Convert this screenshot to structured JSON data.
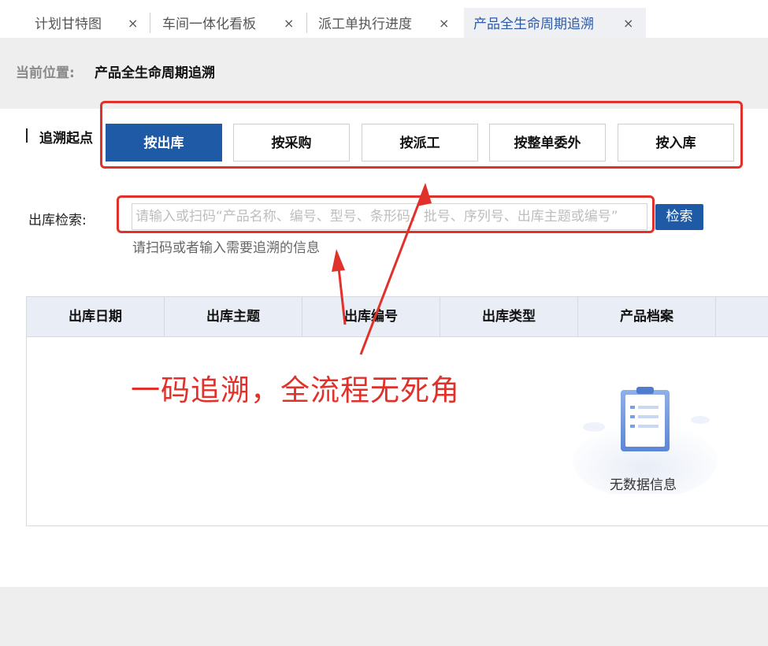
{
  "tabs": [
    {
      "label": "计划甘特图",
      "close": "×"
    },
    {
      "label": "车间一体化看板",
      "close": "×"
    },
    {
      "label": "派工单执行进度",
      "close": "×"
    },
    {
      "label": "产品全生命周期追溯",
      "close": "×"
    }
  ],
  "breadcrumb": {
    "label": "当前位置:",
    "value": "产品全生命周期追溯"
  },
  "trace": {
    "label": "追溯起点",
    "options": [
      "按出库",
      "按采购",
      "按派工",
      "按整单委外",
      "按入库"
    ],
    "selected": "按出库"
  },
  "search": {
    "label": "出库检索:",
    "placeholder": "请输入或扫码“产品名称、编号、型号、条形码、批号、序列号、出库主题或编号”",
    "value": "",
    "button": "检索",
    "hint": "请扫码或者输入需要追溯的信息"
  },
  "table": {
    "columns": [
      "出库日期",
      "出库主题",
      "出库编号",
      "出库类型",
      "产品档案"
    ],
    "rows": [],
    "empty_text": "无数据信息"
  },
  "annotation": "一码追溯，全流程无死角",
  "colors": {
    "accent": "#1f5aa6",
    "annotation_red": "#e0312a",
    "header_bg": "#e9eef6"
  }
}
